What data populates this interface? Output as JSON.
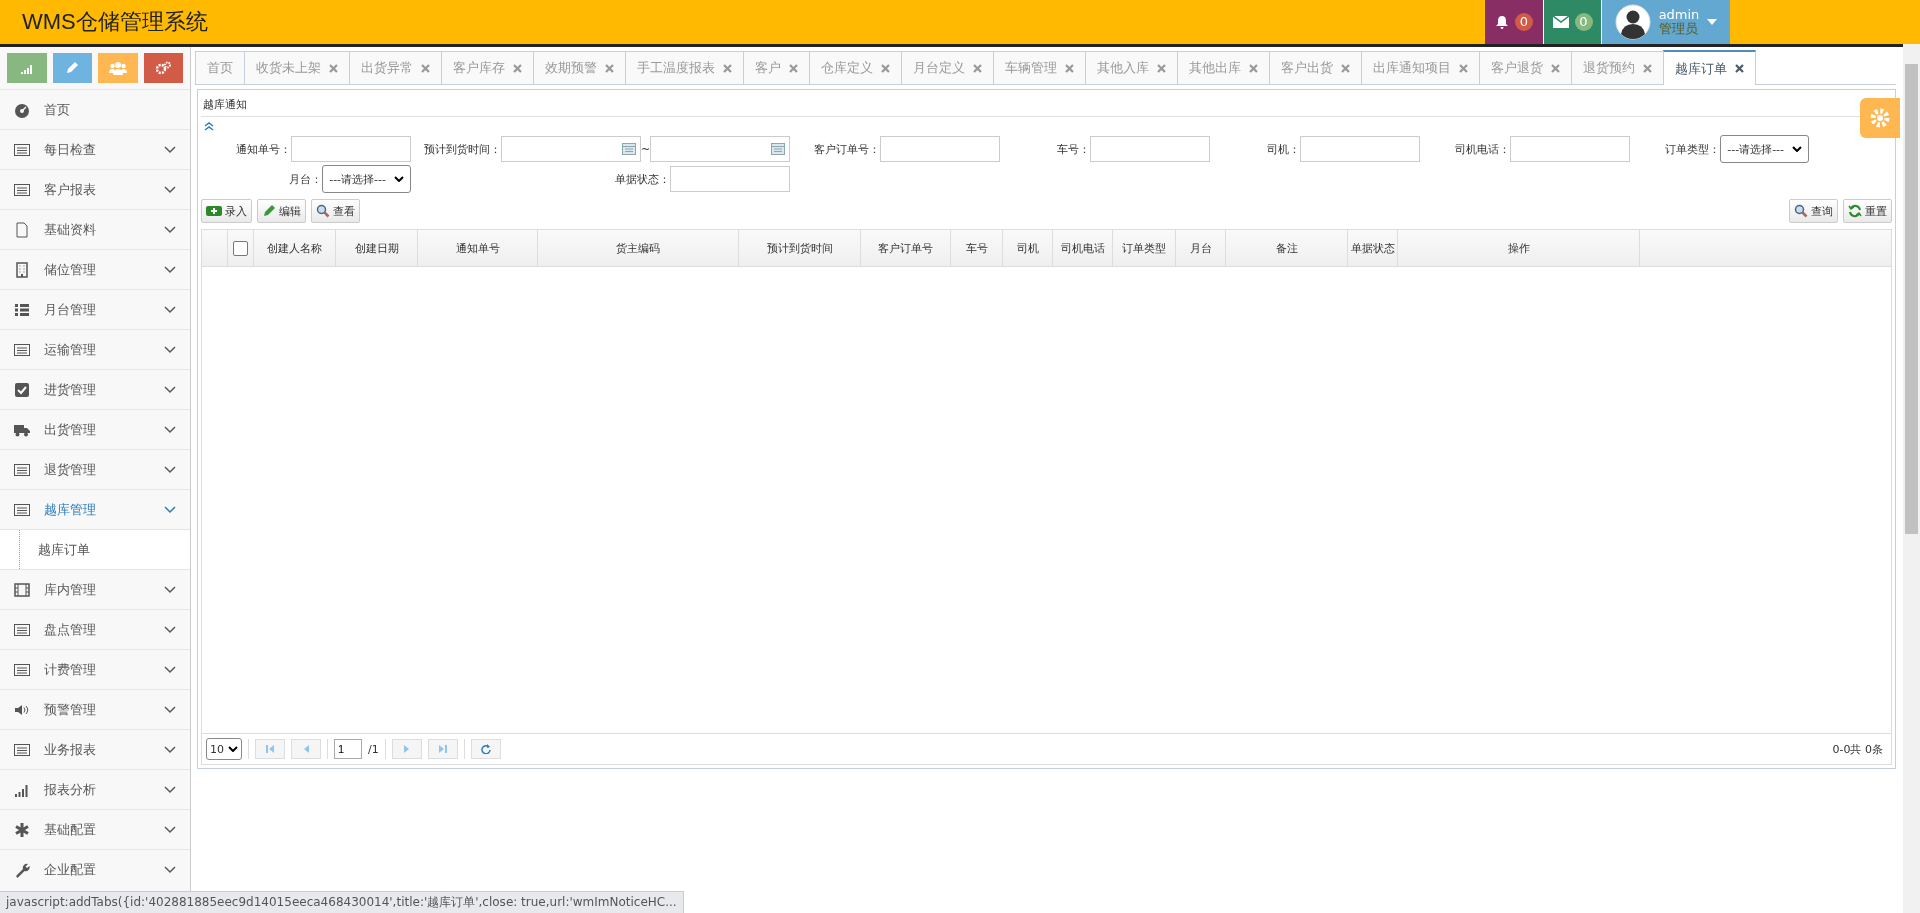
{
  "header": {
    "title": "WMS仓储管理系统",
    "notifications": "0",
    "messages": "0",
    "user": "admin",
    "role": "管理员"
  },
  "sidebar": {
    "items": [
      {
        "label": "首页",
        "expandable": false,
        "expanded": false
      },
      {
        "label": "每日检查",
        "expandable": true,
        "expanded": false
      },
      {
        "label": "客户报表",
        "expandable": true,
        "expanded": false
      },
      {
        "label": "基础资料",
        "expandable": true,
        "expanded": false
      },
      {
        "label": "储位管理",
        "expandable": true,
        "expanded": false
      },
      {
        "label": "月台管理",
        "expandable": true,
        "expanded": false
      },
      {
        "label": "运输管理",
        "expandable": true,
        "expanded": false
      },
      {
        "label": "进货管理",
        "expandable": true,
        "expanded": false
      },
      {
        "label": "出货管理",
        "expandable": true,
        "expanded": false
      },
      {
        "label": "退货管理",
        "expandable": true,
        "expanded": false
      },
      {
        "label": "越库管理",
        "expandable": true,
        "expanded": true,
        "children": [
          {
            "label": "越库订单"
          }
        ]
      },
      {
        "label": "库内管理",
        "expandable": true,
        "expanded": false
      },
      {
        "label": "盘点管理",
        "expandable": true,
        "expanded": false
      },
      {
        "label": "计费管理",
        "expandable": true,
        "expanded": false
      },
      {
        "label": "预警管理",
        "expandable": true,
        "expanded": false
      },
      {
        "label": "业务报表",
        "expandable": true,
        "expanded": false
      },
      {
        "label": "报表分析",
        "expandable": true,
        "expanded": false
      },
      {
        "label": "基础配置",
        "expandable": true,
        "expanded": false
      },
      {
        "label": "企业配置",
        "expandable": true,
        "expanded": false
      }
    ]
  },
  "tabs": [
    {
      "label": "首页",
      "closable": false,
      "selected": false
    },
    {
      "label": "收货未上架",
      "closable": true,
      "selected": false
    },
    {
      "label": "出货异常",
      "closable": true,
      "selected": false
    },
    {
      "label": "客户库存",
      "closable": true,
      "selected": false
    },
    {
      "label": "效期预警",
      "closable": true,
      "selected": false
    },
    {
      "label": "手工温度报表",
      "closable": true,
      "selected": false
    },
    {
      "label": "客户",
      "closable": true,
      "selected": false
    },
    {
      "label": "仓库定义",
      "closable": true,
      "selected": false
    },
    {
      "label": "月台定义",
      "closable": true,
      "selected": false
    },
    {
      "label": "车辆管理",
      "closable": true,
      "selected": false
    },
    {
      "label": "其他入库",
      "closable": true,
      "selected": false
    },
    {
      "label": "其他出库",
      "closable": true,
      "selected": false
    },
    {
      "label": "客户出货",
      "closable": true,
      "selected": false
    },
    {
      "label": "出库通知项目",
      "closable": true,
      "selected": false
    },
    {
      "label": "客户退货",
      "closable": true,
      "selected": false
    },
    {
      "label": "退货预约",
      "closable": true,
      "selected": false
    },
    {
      "label": "越库订单",
      "closable": true,
      "selected": true
    }
  ],
  "panel": {
    "title": "越库通知",
    "filters": [
      {
        "kind": "input",
        "label": "通知单号："
      },
      {
        "kind": "daterange",
        "label": "预计到货时间：",
        "separator": "~"
      },
      {
        "kind": "input",
        "label": "客户订单号："
      },
      {
        "kind": "input",
        "label": "车号："
      },
      {
        "kind": "input",
        "label": "司机："
      },
      {
        "kind": "input",
        "label": "司机电话："
      },
      {
        "kind": "select",
        "label": "订单类型：",
        "value": "---请选择---"
      },
      {
        "kind": "select",
        "label": "月台：",
        "value": "---请选择---"
      },
      {
        "kind": "input",
        "label": "单据状态："
      }
    ],
    "actions": [
      {
        "label": "录入"
      },
      {
        "label": "编辑"
      },
      {
        "label": "查看"
      }
    ],
    "search_actions": [
      {
        "label": "查询"
      },
      {
        "label": "重置"
      }
    ],
    "table": {
      "select_all_checked": false,
      "columns": [
        "创建人名称",
        "创建日期",
        "通知单号",
        "货主编码",
        "预计到货时间",
        "客户订单号",
        "车号",
        "司机",
        "司机电话",
        "订单类型",
        "月台",
        "备注",
        "单据状态",
        "操作"
      ]
    },
    "pager": {
      "page_size": "10",
      "page": "1",
      "pages": "/1",
      "summary": "0-0共 0条"
    }
  },
  "status_bar": "javascript:addTabs({id:'402881885eec9d14015eeca468430014',title:'越库订单',close: true,url:'wmImNoticeHC..."
}
